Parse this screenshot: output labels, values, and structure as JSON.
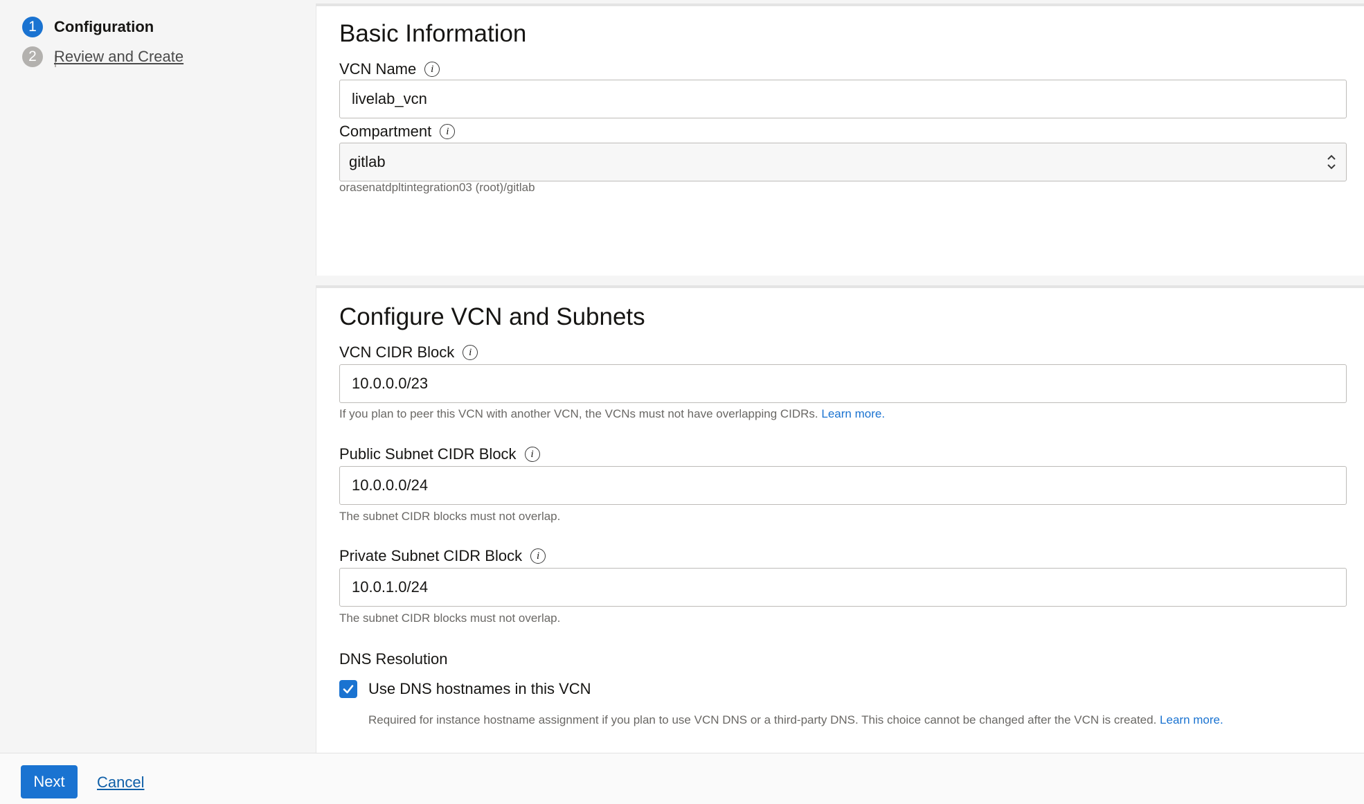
{
  "steps": [
    {
      "number": "1",
      "label": "Configuration"
    },
    {
      "number": "2",
      "label": "Review and Create"
    }
  ],
  "basic_info": {
    "title": "Basic Information",
    "vcn_name": {
      "label": "VCN Name",
      "value": "livelab_vcn"
    },
    "compartment": {
      "label": "Compartment",
      "value": "gitlab",
      "path": "orasenatdpltintegration03 (root)/gitlab"
    }
  },
  "configure": {
    "title": "Configure VCN and Subnets",
    "vcn_cidr": {
      "label": "VCN CIDR Block",
      "value": "10.0.0.0/23",
      "help": "If you plan to peer this VCN with another VCN, the VCNs must not have overlapping CIDRs. ",
      "link": "Learn more."
    },
    "public_subnet": {
      "label": "Public Subnet CIDR Block",
      "value": "10.0.0.0/24",
      "help": "The subnet CIDR blocks must not overlap."
    },
    "private_subnet": {
      "label": "Private Subnet CIDR Block",
      "value": "10.0.1.0/24",
      "help": "The subnet CIDR blocks must not overlap."
    },
    "dns": {
      "title": "DNS Resolution",
      "checkbox_label": "Use DNS hostnames in this VCN",
      "checked": true,
      "help": "Required for instance hostname assignment if you plan to use VCN DNS or a third-party DNS. This choice cannot be changed after the VCN is created. ",
      "link": "Learn more."
    }
  },
  "footer": {
    "next_label": "Next",
    "cancel_label": "Cancel"
  },
  "colors": {
    "accent": "#1a73d1",
    "link": "#0f5fa8",
    "muted": "#6a6865"
  }
}
